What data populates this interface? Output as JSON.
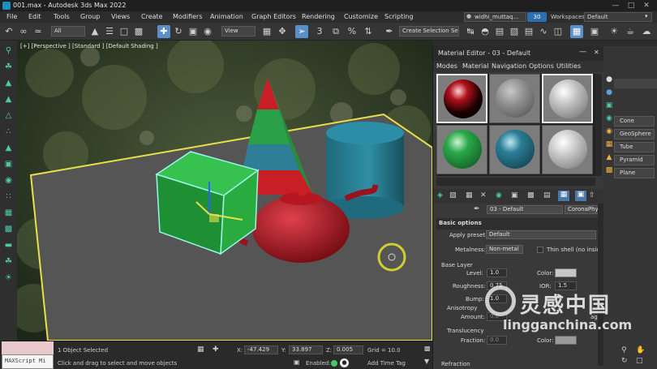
{
  "window": {
    "title": "001.max - Autodesk 3ds Max 2022"
  },
  "menubar": {
    "items": [
      "File",
      "Edit",
      "Tools",
      "Group",
      "Views",
      "Create",
      "Modifiers",
      "Animation",
      "Graph Editors",
      "Rendering",
      "Customize",
      "Scripting"
    ],
    "user": "widhi_muttaq...",
    "notifications": "30",
    "workspaces_label": "Workspaces:",
    "workspace": "Default"
  },
  "toolbar": {
    "selection_filter": "All",
    "ref_coord": "View",
    "named_selection": "Create Selection Se"
  },
  "viewport": {
    "label": "[+] [Perspective ] [Standard ] [Default Shading ]"
  },
  "status": {
    "maxscript": "MAXScript Mi",
    "selected": "1 Object Selected",
    "prompt": "Click and drag to select and move objects",
    "x_label": "X:",
    "x": "-47.429",
    "y_label": "Y:",
    "y": "33.897",
    "z_label": "Z:",
    "z": "0.005",
    "grid": "Grid = 10.0",
    "enabled_label": "Enabled:",
    "add_time_tag": "Add Time Tag"
  },
  "material_editor": {
    "title": "Material Editor - 03 - Default",
    "menu": [
      "Modes",
      "Material",
      "Navigation",
      "Options",
      "Utilities"
    ],
    "slot_colors": [
      "#b0101a",
      "#8e8e8e",
      "#bcbcbc",
      "#2aa84a",
      "#2b7e96",
      "#c4c4c4"
    ],
    "material_name": "03 - Default",
    "material_type": "CoronaPhysicalMt",
    "basic_options": "Basic options",
    "apply_preset_label": "Apply preset:",
    "apply_preset": "Default",
    "metalness_label": "Metalness:",
    "metalness": "Non-metal",
    "thin_shell": "Thin shell (no inside)",
    "base_layer": "Base Layer",
    "level_label": "Level:",
    "level": "1.0",
    "color_label": "Color:",
    "roughness_label": "Roughness:",
    "roughness": "0.75",
    "ior_label": "IOR:",
    "ior": "1.5",
    "bump_label": "Bump:",
    "bump": "1.0",
    "anisotropy": "Anisotropy",
    "amount_label": "Amount:",
    "amount": "0.0",
    "map_label": "ag",
    "translucency": "Translucency",
    "fraction_label": "Fraction:",
    "fraction": "0.0",
    "color2_label": "Color:",
    "refraction": "Refraction"
  },
  "command_panel": {
    "buttons": [
      "Cone",
      "GeoSphere",
      "Tube",
      "Pyramid",
      "Plane"
    ]
  },
  "watermark": {
    "cn": "灵感中国",
    "url": "lingganchina.com"
  }
}
